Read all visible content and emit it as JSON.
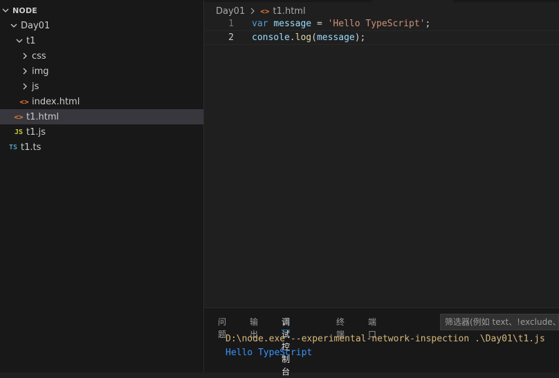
{
  "explorer": {
    "section_title": "NODE",
    "items": [
      {
        "label": "Day01",
        "kind": "folder",
        "expanded": true,
        "icon": "chevron-down-icon"
      },
      {
        "label": "t1",
        "kind": "folder",
        "expanded": true,
        "icon": "chevron-down-icon"
      },
      {
        "label": "css",
        "kind": "folder",
        "expanded": false,
        "icon": "chevron-right-icon"
      },
      {
        "label": "img",
        "kind": "folder",
        "expanded": false,
        "icon": "chevron-right-icon"
      },
      {
        "label": "js",
        "kind": "folder",
        "expanded": false,
        "icon": "chevron-right-icon"
      },
      {
        "label": "index.html",
        "kind": "html",
        "icon": "html-file-icon"
      },
      {
        "label": "t1.html",
        "kind": "html",
        "icon": "html-file-icon",
        "selected": true
      },
      {
        "label": "t1.js",
        "kind": "js",
        "icon": "js-file-icon"
      },
      {
        "label": "t1.ts",
        "kind": "ts",
        "icon": "ts-file-icon"
      }
    ],
    "icon_glyphs": {
      "html": "<>",
      "js": "JS",
      "ts": "TS"
    }
  },
  "editor": {
    "breadcrumb": {
      "folder": "Day01",
      "file": "t1.html"
    },
    "lines": [
      {
        "number": "1",
        "text": "var message = 'Hello TypeScript';"
      },
      {
        "number": "2",
        "text": "console.log(message);"
      }
    ]
  },
  "panel": {
    "tabs": [
      "问题",
      "输出",
      "调试控制台",
      "终端",
      "端口"
    ],
    "active_tab": "调试控制台",
    "filter_placeholder": "筛选器(例如 text、!exclude、\\escape)",
    "console": [
      "D:\\node.exe --experimental-network-inspection .\\Day01\\t1.js",
      "Hello TypeScript"
    ]
  },
  "colors": {
    "selected_row": "#37373d",
    "html_icon": "#e37933",
    "js_icon": "#cbcb41",
    "ts_icon": "#519aba",
    "console_command": "#d7ba7d",
    "console_output": "#3794ff",
    "active_tab_underline": "#0078d4"
  }
}
